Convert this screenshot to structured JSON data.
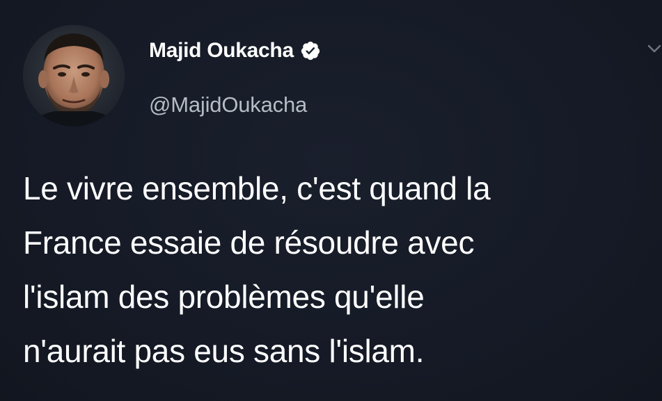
{
  "tweet": {
    "author": {
      "display_name": "Majid Oukacha",
      "handle": "@MajidOukacha",
      "verified": true,
      "avatar_icon": "profile-photo"
    },
    "text_lines": [
      "Le vivre ensemble, c'est quand la",
      "France essaie de résoudre avec",
      "l'islam des problèmes qu'elle",
      "n'aurait pas eus sans l'islam."
    ],
    "menu_icon": "chevron-down-icon"
  },
  "colors": {
    "background": "#15202b",
    "text": "#ffffff",
    "handle": "#b6bcc4",
    "verified_badge": "#ffffff"
  }
}
